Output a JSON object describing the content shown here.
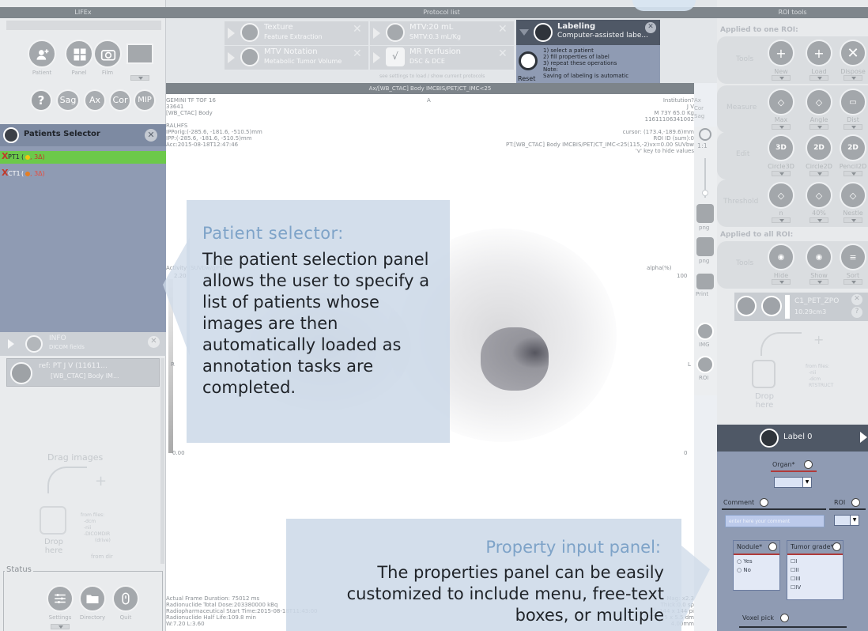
{
  "left": {
    "title": "LIFEx",
    "top_buttons": [
      "Patient",
      "Panel",
      "Film"
    ],
    "view_buttons": [
      "?",
      "Sag",
      "Ax",
      "Cor",
      "MIP"
    ],
    "patients_selector": {
      "title": "Patients Selector",
      "items": [
        {
          "label": "PT1",
          "counts": ", 3Δ)",
          "prefix": "(",
          "selected": true
        },
        {
          "label": "CT1",
          "counts": ", 3Δ)",
          "prefix": "(",
          "selected": false
        }
      ]
    },
    "info": {
      "title": "INFO",
      "subtitle": "DICOM fields"
    },
    "ref": {
      "line1": "ref: PT J V (11611...",
      "line2": "[WB_CTAC] Body IM..."
    },
    "drag_images": "Drag images",
    "drop_here": "Drop here",
    "from_files": "from files:",
    "from_files_list": [
      "-dcm",
      "-nii",
      "-DICOMDIR",
      "(drive)"
    ],
    "from_dir": "from dir",
    "status_label": "Status",
    "bottom_buttons": [
      "Settings",
      "Directory",
      "Quit"
    ]
  },
  "protocol": {
    "title": "Protocol list",
    "items": [
      {
        "title": "Texture",
        "sub": "Feature Extraction"
      },
      {
        "title": "MTV Notation",
        "sub": "Metabolic Tumor Volume"
      },
      {
        "title": "MTV:20 mL",
        "sub": "SMTV:0.3 mL/Kg"
      },
      {
        "title": "MR Perfusion",
        "sub": "DSC & DCE"
      }
    ],
    "footer_hint": "see settings to load / show current protocols",
    "labeling": {
      "title": "Labeling",
      "sub": "Computer-assisted labe...",
      "steps": [
        "1) select a patient",
        "2) fill properties of label",
        "3) repeat these operations",
        "Note:",
        "Saving of labeling is automatic"
      ],
      "reset": "Reset"
    }
  },
  "viewer": {
    "title": "Ax/[WB_CTAC] Body IMCBIS/PET/CT_IMC<25",
    "tl": [
      "GEMINI TF TOF 16",
      "33641",
      "[WB_CTAC] Body",
      "",
      "RAI,HFS",
      "IPPorig:(-285.6, -181.6, -510.5)mm",
      "IPP:(-285.6, -181.6, -510.5)mm",
      "Acc:2015-08-18T12:47:46"
    ],
    "tr": [
      "Institution?",
      "J V",
      "M 73Y 65.0 Kg",
      "11611106341002",
      "",
      "cursor: (173.4,-189.6)mm",
      "ROI ID (sum):0",
      "PT:[WB_CTAC] Body IMCBIS/PET/CT_IMC<25(115,-2)vx=0.00 SUVbw",
      "'v' key to hide values"
    ],
    "side_opts": [
      "Ax",
      "Cor",
      "Sag"
    ],
    "top_letter": "A",
    "left_letter": "R",
    "right_letter": "L",
    "activity_label": "Activity (SUVbw/g/ml)",
    "activity_max": "2.20",
    "activity_min": "0.00",
    "alpha_label": "alpha(%)",
    "alpha_val": "100",
    "zero_label": "0",
    "bl": [
      "Actual Frame Duration: 75012 ms",
      "Radionuclide Total Dose:203380000 kBq",
      "Radiopharmaceutical Start Time:2015-08-18T11:43:00",
      "Radionuclide Half Life:109.8 min",
      "W:7.20 L:3.60"
    ],
    "br": [
      "Mag: x2.3",
      "Thick:0.0 sp",
      "zd: 144 x 144 pi",
      "DSC: 5.5 x 5.5 dm",
      "4.00mm"
    ],
    "zoom_label": "1:1",
    "png_labels": [
      "png",
      "png"
    ],
    "print_label": "Print",
    "img_label": "IMG",
    "roi_label": "ROI"
  },
  "roi_tools": {
    "title": "ROI tools",
    "one_roi": "Applied to one ROI:",
    "all_roi": "Applied to all ROI:",
    "rows": [
      {
        "name": "Tools",
        "items": [
          "New",
          "Load",
          "Dispose"
        ]
      },
      {
        "name": "Measure",
        "items": [
          "Max",
          "Angle",
          "Dist"
        ]
      },
      {
        "name": "Edit",
        "items": [
          "Circle3D",
          "Circle2D",
          "Pencil2D"
        ]
      },
      {
        "name": "Threshold",
        "items": [
          "n",
          "40%",
          "Nestle"
        ]
      }
    ],
    "all_row": {
      "name": "Tools",
      "items": [
        "Hide",
        "Show",
        "Sort"
      ]
    },
    "roi_item": {
      "name": "C1_PET_ZPO",
      "vol": "10.29cm3"
    },
    "drop_here": "Drop here",
    "from_files": "from files:",
    "from_files_list": [
      "-nii",
      "-dcm",
      "RTSTRUCT"
    ],
    "label0": "Label 0",
    "organ": "Organ*",
    "comment": "Comment",
    "comment_ph": "enter here your comment",
    "roi": "ROI",
    "nodule": "Nodule*",
    "nodule_opts": [
      "Yes",
      "No"
    ],
    "tumor": "Tumor grade*",
    "tumor_opts": [
      "I",
      "II",
      "III",
      "IV"
    ],
    "voxel": "Voxel pick"
  },
  "callouts": {
    "patient_title": "Patient selector:",
    "patient_body": "The patient selection panel allows the user to specify a list of patients whose images are then automatically loaded as annotation tasks are completed.",
    "property_title": "Property input panel:",
    "property_body": "The properties panel can be easily customized to include menu, free-text boxes, or multiple"
  },
  "colors": {
    "accent_green": "#6cc94a",
    "panel_blue": "#8e9cb8",
    "callout_bg": "#d6e2ee",
    "callout_title": "#7ea3c8"
  }
}
